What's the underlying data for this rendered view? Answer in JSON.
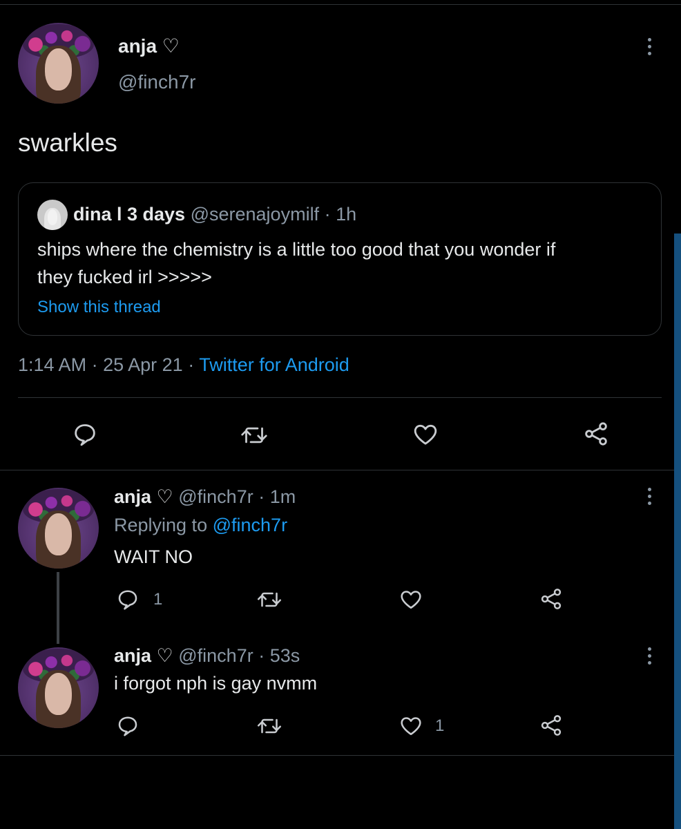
{
  "main_tweet": {
    "display_name": "anja ♡",
    "handle": "@finch7r",
    "text": "swarkles",
    "time": "1:14 AM",
    "date": "25 Apr 21",
    "client": "Twitter for Android",
    "sep": "·"
  },
  "quoted_tweet": {
    "display_name": "dina l 3 days",
    "handle": "@serenajoymilf",
    "age": "1h",
    "line1": "ships where the chemistry is a little too good that you wonder if",
    "line2": "they fucked irl >>>>>",
    "show_thread": "Show this thread",
    "sep": "·"
  },
  "replies": [
    {
      "display_name": "anja ♡",
      "handle": "@finch7r",
      "age": "1m",
      "replying_prefix": "Replying to",
      "replying_handle": "@finch7r",
      "text": "WAIT NO",
      "reply_count": "1",
      "like_count": "",
      "sep": "·"
    },
    {
      "display_name": "anja ♡",
      "handle": "@finch7r",
      "age": "53s",
      "text": "i forgot nph is gay nvmm",
      "reply_count": "",
      "like_count": "1",
      "sep": "·"
    }
  ],
  "icons": {
    "more": "more-vertical-icon",
    "reply": "reply-icon",
    "retweet": "retweet-icon",
    "like": "heart-icon",
    "share": "share-icon"
  },
  "colors": {
    "background": "#000000",
    "text": "#e7e9ea",
    "muted": "#8b98a5",
    "link": "#1d9bf0",
    "divider": "#2f3336"
  }
}
